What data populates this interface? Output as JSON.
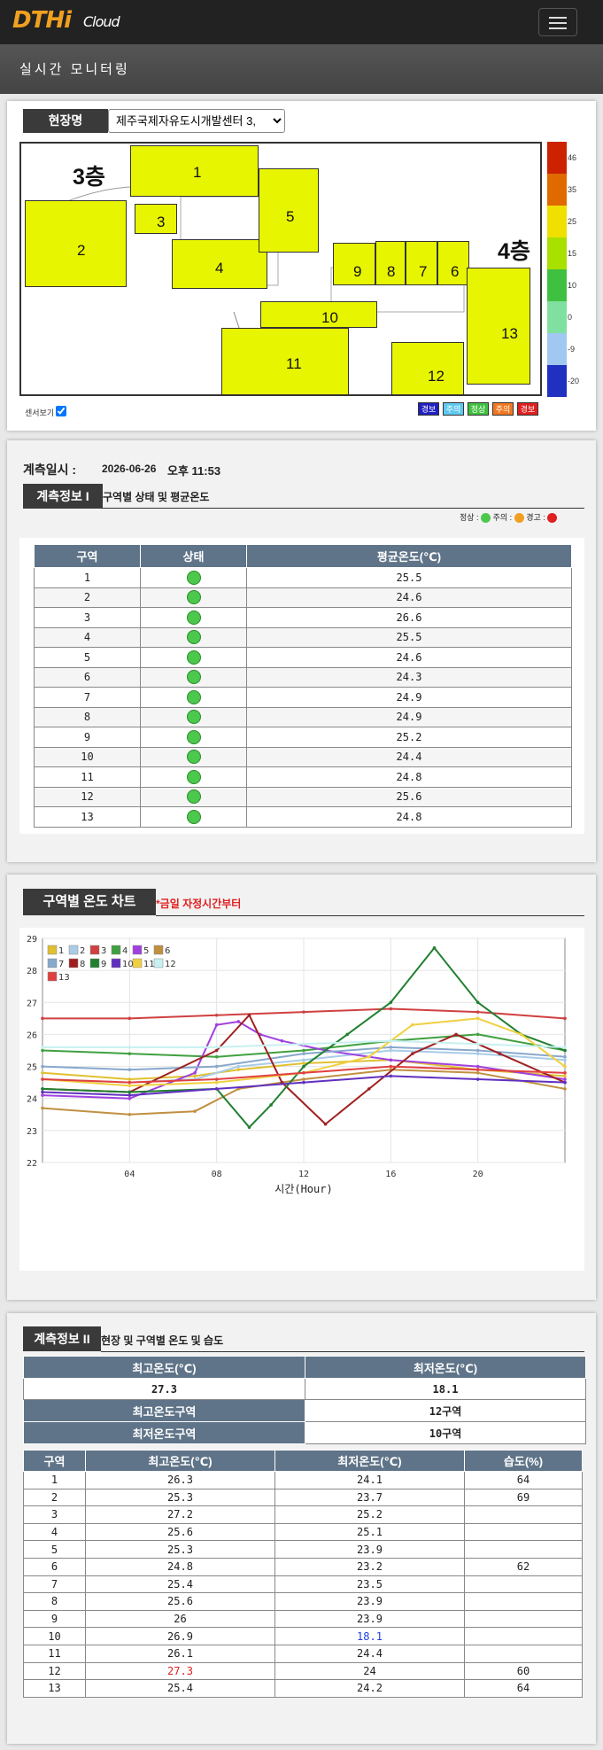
{
  "header": {
    "logo": "DTHi",
    "logo_sub": "Cloud",
    "subtitle": "실시간 모니터링"
  },
  "site": {
    "label": "현장명",
    "selected": "제주국제자유도시개발센터 3,"
  },
  "map": {
    "floor3": "3층",
    "floor4": "4층",
    "zones": [
      "1",
      "2",
      "3",
      "4",
      "5",
      "6",
      "7",
      "8",
      "9",
      "10",
      "11",
      "12",
      "13"
    ],
    "scale_colors": [
      "#cc2200",
      "#e06a00",
      "#f0e000",
      "#a8e000",
      "#40c040",
      "#80e0a0",
      "#a0c8f0",
      "#2030c0"
    ],
    "scale_labels": [
      "46",
      "35",
      "25",
      "15",
      "10",
      "0",
      "-9",
      "-20"
    ],
    "sensor_toggle": "센서보기",
    "legend": [
      {
        "label": "경보",
        "color": "#2020c0"
      },
      {
        "label": "주의",
        "color": "#60c8f0"
      },
      {
        "label": "정상",
        "color": "#40c040"
      },
      {
        "label": "주의",
        "color": "#f07820"
      },
      {
        "label": "경보",
        "color": "#e02020"
      }
    ]
  },
  "measure": {
    "date_label": "계측일시 :",
    "date_value": "2026-06-26",
    "time_value": "오후 11:53",
    "info1_label": "계측정보 I",
    "info1_desc": "구역별 상태 및 평균온도",
    "status_legend": {
      "normal": "정상 :",
      "caution": "주의 :",
      "warning": "경고 :"
    }
  },
  "table1": {
    "headers": [
      "구역",
      "상태",
      "평균온도(℃)"
    ],
    "rows": [
      [
        "1",
        "25.5"
      ],
      [
        "2",
        "24.6"
      ],
      [
        "3",
        "26.6"
      ],
      [
        "4",
        "25.5"
      ],
      [
        "5",
        "24.6"
      ],
      [
        "6",
        "24.3"
      ],
      [
        "7",
        "24.9"
      ],
      [
        "8",
        "24.9"
      ],
      [
        "9",
        "25.2"
      ],
      [
        "10",
        "24.4"
      ],
      [
        "11",
        "24.8"
      ],
      [
        "12",
        "25.6"
      ],
      [
        "13",
        "24.8"
      ]
    ]
  },
  "chart_section": {
    "title": "구역별 온도 차트",
    "note": "*금일 자정시간부터"
  },
  "chart_data": {
    "type": "line",
    "xlabel": "시간(Hour)",
    "ylabel": "",
    "xlim": [
      0,
      24
    ],
    "ylim": [
      22,
      29
    ],
    "x_ticks": [
      "04",
      "08",
      "12",
      "16",
      "20"
    ],
    "y_ticks": [
      "22",
      "23",
      "24",
      "25",
      "26",
      "27",
      "28",
      "29"
    ],
    "legend_position": "top-left",
    "series": [
      {
        "name": "1",
        "color": "#e0c030",
        "x": [
          0,
          4,
          7,
          9,
          12,
          16,
          20,
          24
        ],
        "y": [
          24.8,
          24.6,
          24.7,
          24.9,
          25.1,
          25.2,
          24.9,
          24.7
        ]
      },
      {
        "name": "2",
        "color": "#a8cce8",
        "x": [
          0,
          4,
          7,
          9,
          12,
          16,
          20,
          24
        ],
        "y": [
          24.6,
          24.5,
          24.6,
          25.0,
          25.2,
          25.5,
          25.4,
          25.2
        ]
      },
      {
        "name": "3",
        "color": "#d04040",
        "x": [
          0,
          4,
          8,
          12,
          16,
          20,
          24
        ],
        "y": [
          26.5,
          26.5,
          26.6,
          26.7,
          26.8,
          26.7,
          26.5
        ]
      },
      {
        "name": "4",
        "color": "#40a040",
        "x": [
          0,
          4,
          8,
          12,
          16,
          20,
          24
        ],
        "y": [
          25.5,
          25.4,
          25.3,
          25.5,
          25.8,
          26.0,
          25.5
        ]
      },
      {
        "name": "5",
        "color": "#a040e0",
        "x": [
          0,
          4,
          7,
          8,
          9,
          10,
          11,
          13,
          16,
          20,
          24
        ],
        "y": [
          24.1,
          24.0,
          24.8,
          26.3,
          26.4,
          26.0,
          25.8,
          25.5,
          25.2,
          25.0,
          24.6
        ]
      },
      {
        "name": "6",
        "color": "#c09040",
        "x": [
          0,
          4,
          7,
          9,
          12,
          16,
          20,
          24
        ],
        "y": [
          23.7,
          23.5,
          23.6,
          24.3,
          24.6,
          24.9,
          24.8,
          24.3
        ]
      },
      {
        "name": "7",
        "color": "#88a8cc",
        "x": [
          0,
          4,
          8,
          12,
          16,
          20,
          24
        ],
        "y": [
          25.0,
          24.9,
          25.0,
          25.4,
          25.6,
          25.5,
          25.3
        ]
      },
      {
        "name": "8",
        "color": "#a02020",
        "x": [
          0,
          4,
          8,
          9.5,
          11,
          13,
          15,
          17,
          19,
          21,
          24
        ],
        "y": [
          24.3,
          24.2,
          25.5,
          26.6,
          24.5,
          23.2,
          24.3,
          25.4,
          26.0,
          25.4,
          24.5
        ]
      },
      {
        "name": "9",
        "color": "#208030",
        "x": [
          0,
          4,
          8,
          9.5,
          10.5,
          12,
          14,
          16,
          18,
          20,
          22,
          24
        ],
        "y": [
          24.3,
          24.2,
          24.3,
          23.1,
          23.8,
          25.0,
          26.0,
          27.0,
          28.7,
          27.0,
          26.0,
          25.5
        ]
      },
      {
        "name": "10",
        "color": "#6030c0",
        "x": [
          0,
          4,
          8,
          12,
          16,
          20,
          24
        ],
        "y": [
          24.2,
          24.1,
          24.3,
          24.5,
          24.7,
          24.6,
          24.5
        ]
      },
      {
        "name": "11",
        "color": "#f0d040",
        "x": [
          0,
          4,
          8,
          12,
          15,
          17,
          20,
          22,
          24
        ],
        "y": [
          24.6,
          24.4,
          24.5,
          24.8,
          25.3,
          26.3,
          26.5,
          26.0,
          25.0
        ]
      },
      {
        "name": "12",
        "color": "#c8f0f0",
        "x": [
          0,
          4,
          8,
          12,
          16,
          20,
          24
        ],
        "y": [
          25.6,
          25.6,
          25.6,
          25.7,
          25.8,
          25.7,
          25.6
        ]
      },
      {
        "name": "13",
        "color": "#e04040",
        "x": [
          0,
          4,
          8,
          12,
          16,
          20,
          24
        ],
        "y": [
          24.6,
          24.5,
          24.6,
          24.8,
          25.0,
          24.9,
          24.8
        ]
      }
    ]
  },
  "info2": {
    "label": "계측정보 II",
    "desc": "현장 및 구역별 온도 및 습도",
    "max_temp_header": "최고온도(℃)",
    "min_temp_header": "최저온도(℃)",
    "max_temp": "27.3",
    "min_temp": "18.1",
    "max_zone_label": "최고온도구역",
    "max_zone": "12구역",
    "min_zone_label": "최저온도구역",
    "min_zone": "10구역"
  },
  "table3": {
    "headers": [
      "구역",
      "최고온도(℃)",
      "최저온도(℃)",
      "습도(%)"
    ],
    "rows": [
      [
        "1",
        "26.3",
        "24.1",
        "64"
      ],
      [
        "2",
        "25.3",
        "23.7",
        "69"
      ],
      [
        "3",
        "27.2",
        "25.2",
        ""
      ],
      [
        "4",
        "25.6",
        "25.1",
        ""
      ],
      [
        "5",
        "25.3",
        "23.9",
        ""
      ],
      [
        "6",
        "24.8",
        "23.2",
        "62"
      ],
      [
        "7",
        "25.4",
        "23.5",
        ""
      ],
      [
        "8",
        "25.6",
        "23.9",
        ""
      ],
      [
        "9",
        "26",
        "23.9",
        ""
      ],
      [
        "10",
        "26.9",
        "18.1",
        ""
      ],
      [
        "11",
        "26.1",
        "24.4",
        ""
      ],
      [
        "12",
        "27.3",
        "24",
        "60"
      ],
      [
        "13",
        "25.4",
        "24.2",
        "64"
      ]
    ]
  }
}
